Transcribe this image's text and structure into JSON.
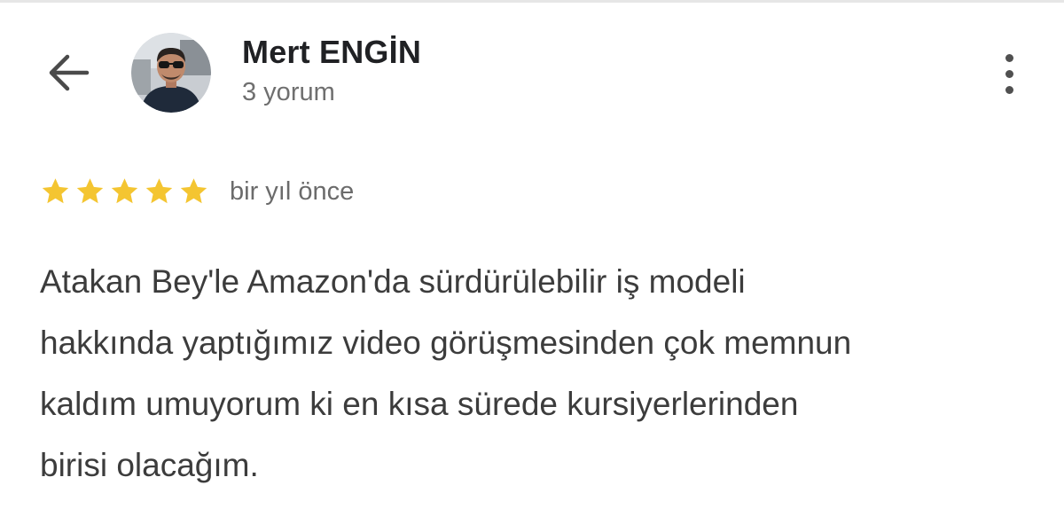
{
  "reviewer": {
    "name": "Mert ENGİN",
    "review_count": "3 yorum",
    "avatar_icon": "person-avatar-icon"
  },
  "header": {
    "back_icon": "arrow-left-icon",
    "more_icon": "more-vertical-icon"
  },
  "review": {
    "rating": 5,
    "max_rating": 5,
    "star_color": "#f4c531",
    "date": "bir yıl önce",
    "text_lines": [
      "Atakan Bey'le Amazon'da sürdürülebilir iş modeli",
      "hakkında yaptığımız video görüşmesinden çok memnun",
      "kaldım umuyorum ki en kısa sürede kursiyerlerinden",
      "birisi olacağım."
    ]
  }
}
